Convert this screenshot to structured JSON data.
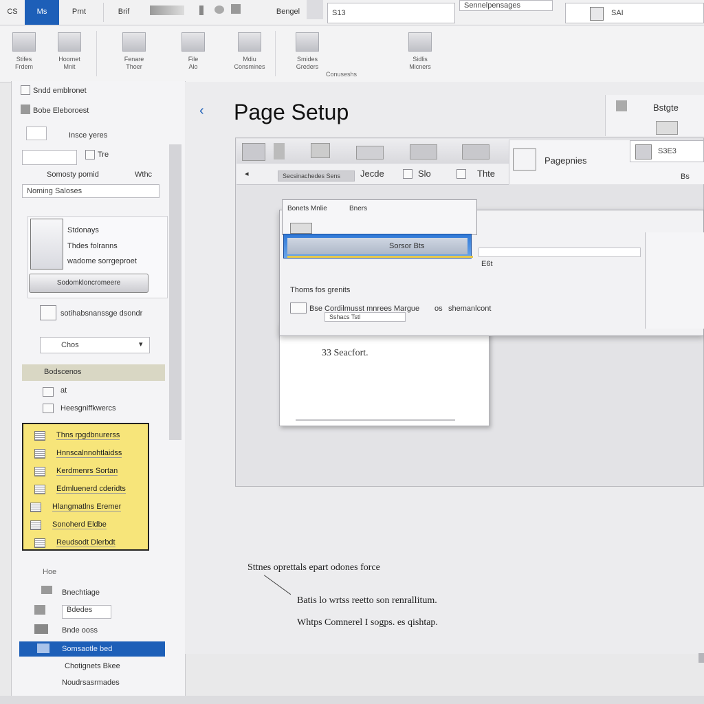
{
  "tabstrip": {
    "tabs": [
      "CS",
      "Ms",
      "Prnt",
      "Brif",
      "Bengel"
    ],
    "search_value": "S13",
    "center_field": "Sennelpensages",
    "right_field": "SAI"
  },
  "ribbon": {
    "groups": [
      {
        "label": "Stifes\nFrdem"
      },
      {
        "label": "Hoomet\nMnit"
      },
      {
        "label": "Fenare\nThoer"
      },
      {
        "label": "File\nAlo"
      },
      {
        "label": "Mdiu\nConsmines"
      },
      {
        "label": "Smides\nGreders"
      },
      {
        "label": "Sidlis\nMicners"
      }
    ],
    "sub_label": "Conuseshs"
  },
  "left_pane": {
    "items": [
      "Sndd emblronet",
      "Bobe Eleboroest",
      "Insce yeres",
      "Tre",
      "Somosty pomid",
      "Wthc",
      "Noming Saloses"
    ],
    "card_title": "Stdonays",
    "card_line1": "Thdes folranns",
    "card_line2": "wadome sorrgeproet",
    "card_button": "Sodomkloncromeere",
    "option_label": "sotihabsnanssge dsondr",
    "dropdown_value": "Chos",
    "section_header": "Bodscenos",
    "checkbox_label": "at",
    "style_label": "Heesgniffkwercs",
    "yellow_list": [
      "Thns rpgdbnurerss",
      "Hnnscalnnohtlaidss",
      "Kerdmenrs Sortan",
      "Edmluenerd cderidts",
      "Hlangmatlns Eremer",
      "Sonoherd Eldbe",
      "Reudsodt Dlerbdt"
    ],
    "lower_items": [
      "Hoe",
      "Bnechtiage",
      "Bdedes",
      "Bnde ooss",
      "Somsaotle bed",
      "Chotignets Bkee",
      "Noudrsasrmades"
    ]
  },
  "main": {
    "back": "‹",
    "title": "Page Setup",
    "right_header": "Bstgte",
    "dialog": {
      "tabs": [
        "Secsinachedes Sens",
        "Jecde",
        "Slo",
        "Thte"
      ],
      "page_preview_label": "Pagepnies",
      "page_field": "S3E3",
      "page_hint": "Bs",
      "inner_title": "Bonets Mnlie",
      "inner_sub": "Bners",
      "bluebar_label": "Sorsor  Bts",
      "right_value": "E6t",
      "line1": "Thoms  fos  grenits",
      "line2": "Bse Cordilmusst  mnrees Margue",
      "line2_suffix": "os",
      "line2_right": "shemanlcont",
      "line3": "Sshacs  Tstl",
      "paper_text": "33  Seacfort."
    }
  },
  "notes": {
    "note1": "Sttnes  oprettals epart  odones force",
    "note2": "Batis  lo  wrtss  reetto son  renrallitum.",
    "note3": "Whtps  Comnerel I sogps.  es  qishtap."
  }
}
